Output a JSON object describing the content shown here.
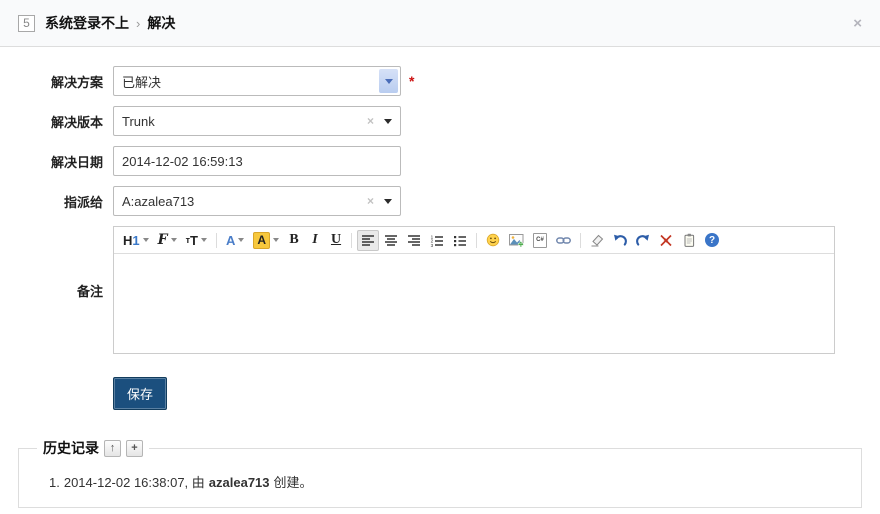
{
  "window": {
    "id": "5",
    "title": "系统登录不上",
    "separator": "›",
    "action": "解决",
    "close_icon": "×"
  },
  "form": {
    "fields": {
      "resolution": {
        "label": "解决方案",
        "value": "已解决",
        "required_mark": "*"
      },
      "resolved_build": {
        "label": "解决版本",
        "value": "Trunk",
        "clear_icon": "×"
      },
      "resolved_date": {
        "label": "解决日期",
        "value": "2014-12-02 16:59:13"
      },
      "assigned_to": {
        "label": "指派给",
        "value": "A:azalea713",
        "clear_icon": "×"
      },
      "comment": {
        "label": "备注",
        "value": ""
      }
    },
    "save_label": "保存"
  },
  "editor_toolbar": {
    "heading_h": "H",
    "heading_num": "1",
    "font_family_letter": "F",
    "size_small": "т",
    "size_large": "T",
    "color_letter": "A",
    "highlight_letter": "A",
    "bold_letter": "B",
    "italic_letter": "I",
    "underline_letter": "U",
    "code_label": "C#",
    "help_mark": "?"
  },
  "history": {
    "title": "历史记录",
    "collapse_icon": "↑",
    "add_icon": "+",
    "entries": [
      {
        "index": "1.",
        "time": "2014-12-02 16:38:07, 由",
        "user": "azalea713",
        "suffix": "创建。"
      }
    ]
  },
  "colors": {
    "save_button": "#1b4f7e",
    "required_mark": "#cc1111",
    "select_arrow_bg": "#c5d4f2",
    "highlight_yellow": "#f7c83d",
    "undo_redo_blue": "#2d5da8",
    "fullscreen_red": "#c33522",
    "help_blue": "#3a75c8"
  }
}
